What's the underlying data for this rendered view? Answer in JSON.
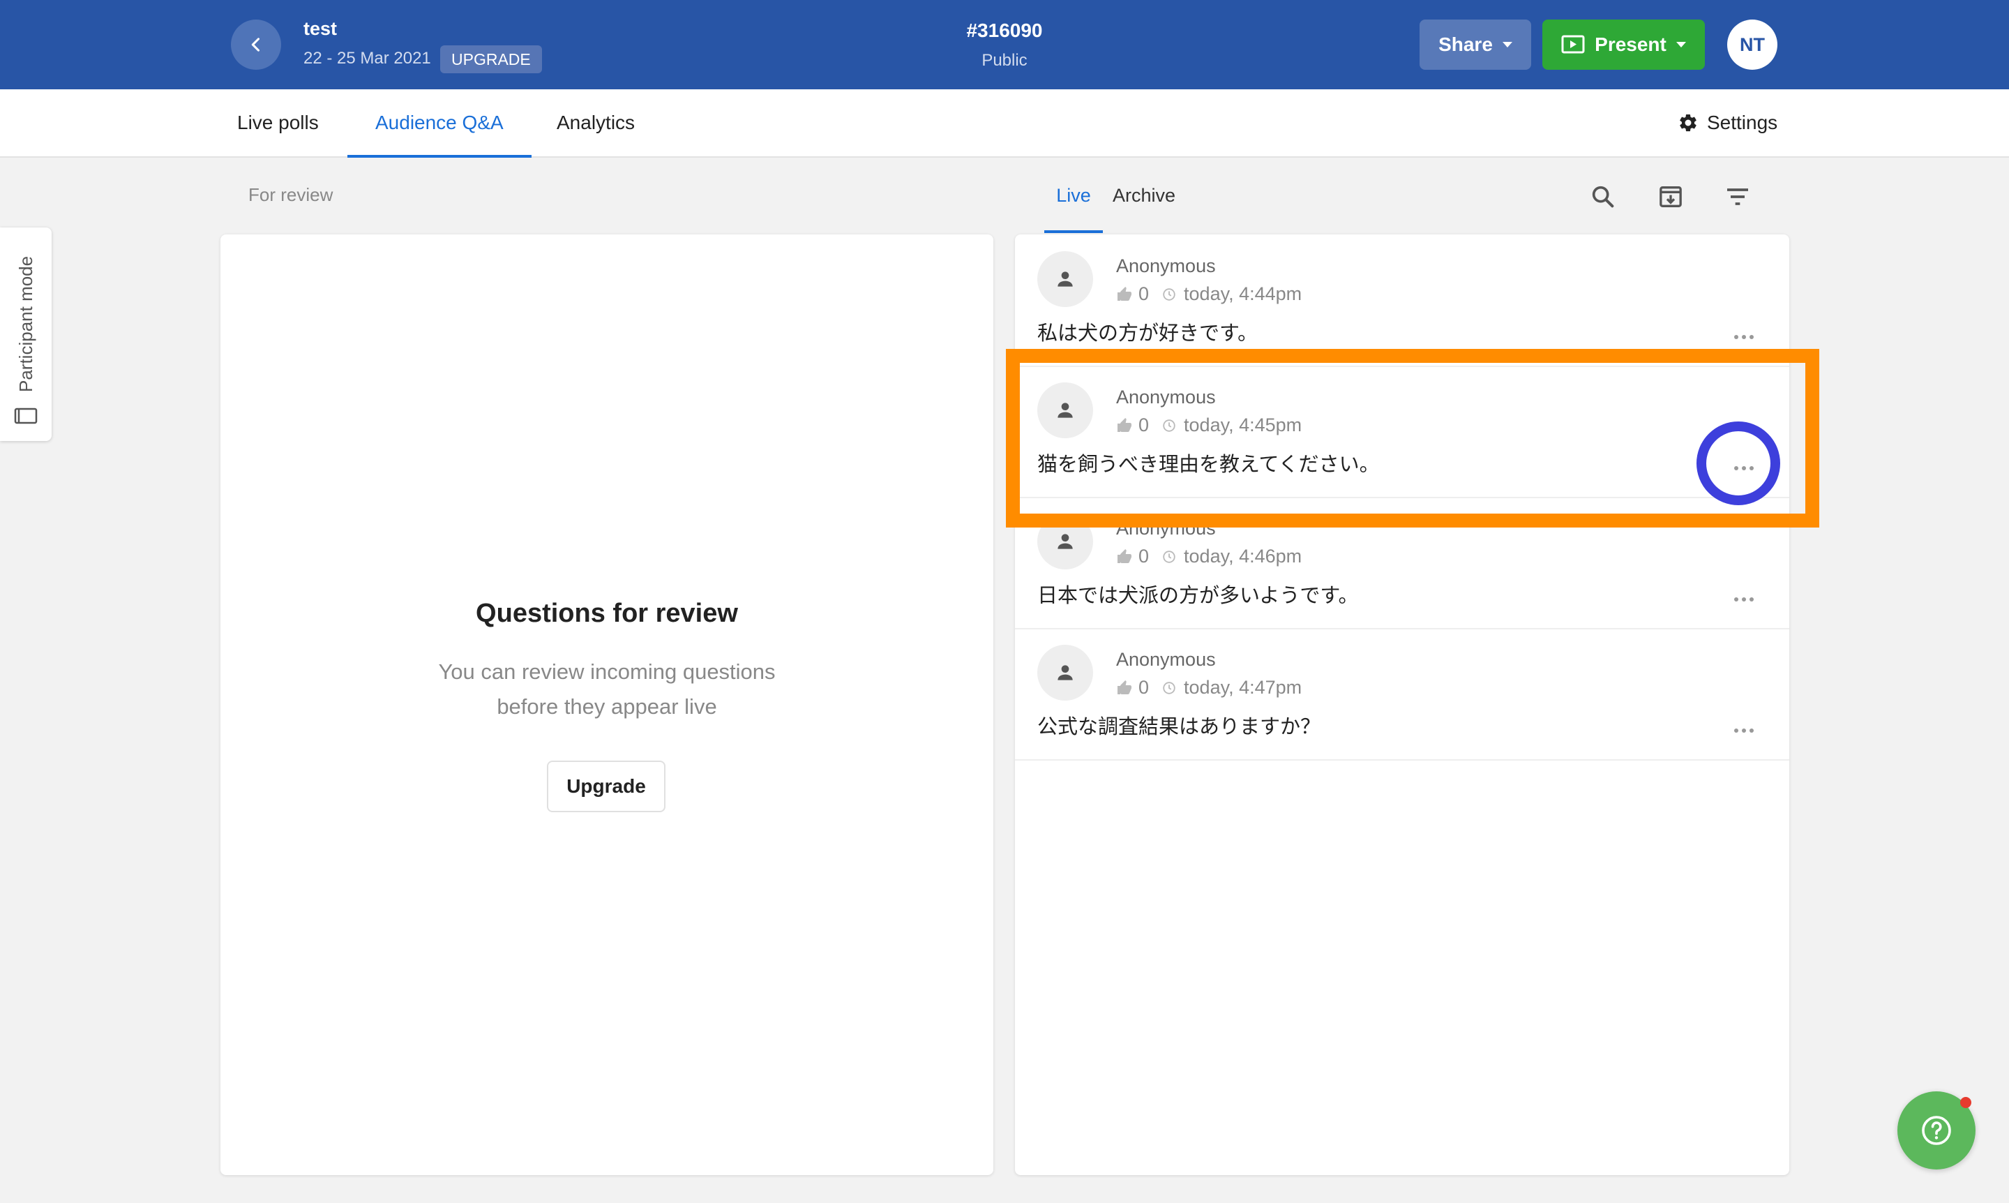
{
  "header": {
    "event_title": "test",
    "event_dates": "22 - 25 Mar 2021",
    "upgrade_badge": "UPGRADE",
    "event_code": "#316090",
    "event_visibility": "Public",
    "share_label": "Share",
    "present_label": "Present",
    "user_initials": "NT"
  },
  "nav": {
    "tabs": [
      {
        "label": "Live polls",
        "active": false
      },
      {
        "label": "Audience Q&A",
        "active": true
      },
      {
        "label": "Analytics",
        "active": false
      }
    ],
    "settings_label": "Settings"
  },
  "side": {
    "participant_mode_label": "Participant mode"
  },
  "review": {
    "section_label": "For review",
    "title": "Questions for review",
    "description_line1": "You can review incoming questions",
    "description_line2": "before they appear live",
    "upgrade_button": "Upgrade"
  },
  "qa": {
    "tabs": [
      {
        "label": "Live",
        "active": true
      },
      {
        "label": "Archive",
        "active": false
      }
    ],
    "questions": [
      {
        "author": "Anonymous",
        "votes": "0",
        "time": "today, 4:44pm",
        "text": "私は犬の方が好きです。"
      },
      {
        "author": "Anonymous",
        "votes": "0",
        "time": "today, 4:45pm",
        "text": "猫を飼うべき理由を教えてください。"
      },
      {
        "author": "Anonymous",
        "votes": "0",
        "time": "today, 4:46pm",
        "text": "日本では犬派の方が多いようです。"
      },
      {
        "author": "Anonymous",
        "votes": "0",
        "time": "today, 4:47pm",
        "text": "公式な調査結果はありますか？"
      }
    ]
  },
  "colors": {
    "header_bg": "#2855a6",
    "present_green": "#2ea836",
    "active_blue": "#1a6fd8",
    "highlight_orange": "#ff8c00",
    "highlight_circle": "#3d3fdc",
    "help_green": "#5cb85c"
  }
}
